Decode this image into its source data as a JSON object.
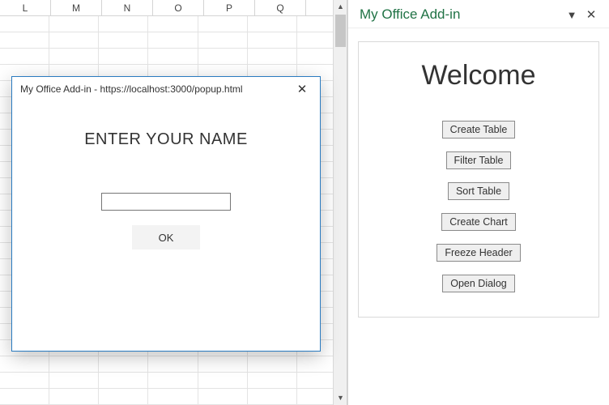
{
  "sheet": {
    "columns": [
      "L",
      "M",
      "N",
      "O",
      "P",
      "Q"
    ]
  },
  "taskpane": {
    "title": "My Office Add-in",
    "welcome": "Welcome",
    "buttons": {
      "create_table": "Create Table",
      "filter_table": "Filter Table",
      "sort_table": "Sort Table",
      "create_chart": "Create Chart",
      "freeze_header": "Freeze Header",
      "open_dialog": "Open Dialog"
    }
  },
  "popup": {
    "title": "My Office Add-in - https://localhost:3000/popup.html",
    "heading": "ENTER YOUR NAME",
    "name_value": "",
    "ok_label": "OK"
  }
}
